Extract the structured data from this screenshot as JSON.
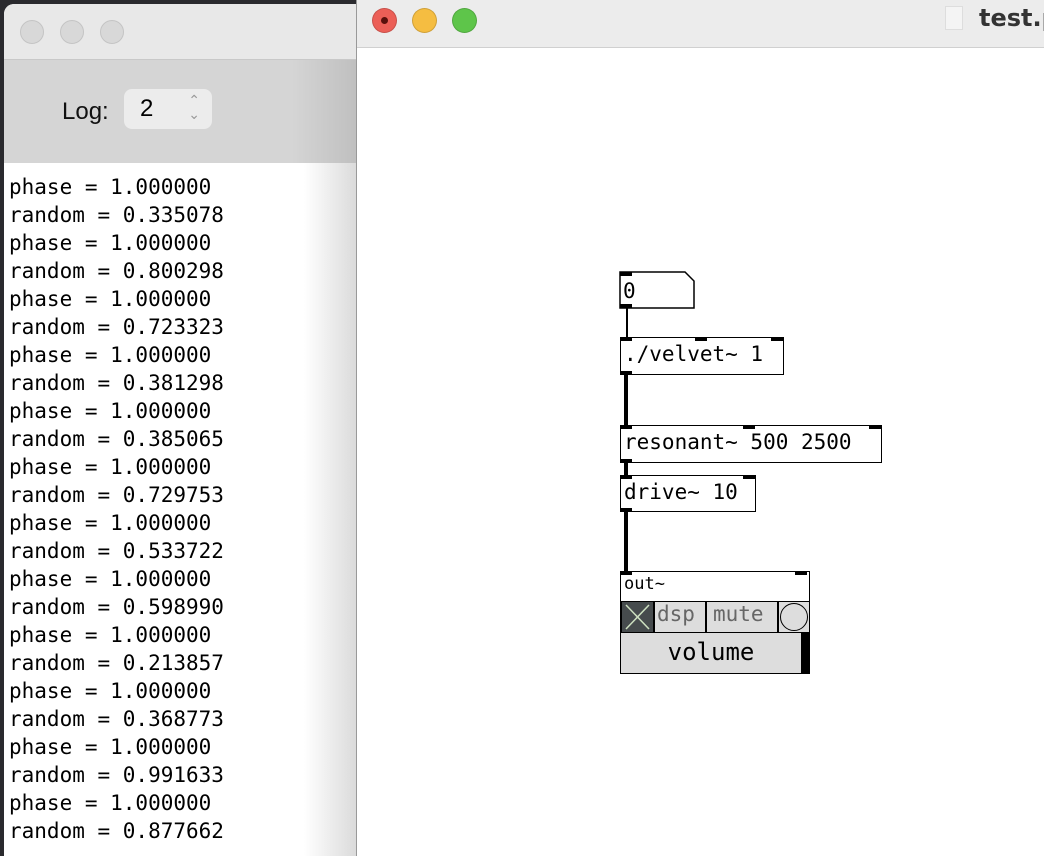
{
  "log_window": {
    "log_label": "Log:",
    "log_level": "2",
    "lines": [
      "phase = 1.000000",
      "random = 0.335078",
      "phase = 1.000000",
      "random = 0.800298",
      "phase = 1.000000",
      "random = 0.723323",
      "phase = 1.000000",
      "random = 0.381298",
      "phase = 1.000000",
      "random = 0.385065",
      "phase = 1.000000",
      "random = 0.729753",
      "phase = 1.000000",
      "random = 0.533722",
      "phase = 1.000000",
      "random = 0.598990",
      "phase = 1.000000",
      "random = 0.213857",
      "phase = 1.000000",
      "random = 0.368773",
      "phase = 1.000000",
      "random = 0.991633",
      "phase = 1.000000",
      "random = 0.877662"
    ]
  },
  "patch_window": {
    "title": "test.p",
    "number_box": "0",
    "objects": {
      "velvet": "./velvet~ 1",
      "resonant": "resonant~ 500 2500",
      "drive": "drive~ 10",
      "out": "out~"
    },
    "out_gui": {
      "dsp": "dsp",
      "mute": "mute",
      "volume": "volume"
    },
    "colors": {
      "close": "#ec5f57",
      "minimize": "#f5bd41",
      "maximize": "#5ec54a"
    }
  }
}
